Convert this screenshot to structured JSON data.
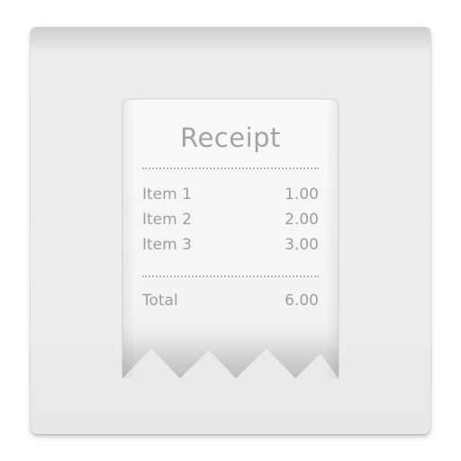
{
  "receipt": {
    "title": "Receipt",
    "items": [
      {
        "name": "Item 1",
        "amount": "1.00"
      },
      {
        "name": "Item 2",
        "amount": "2.00"
      },
      {
        "name": "Item 3",
        "amount": "3.00"
      }
    ],
    "total": {
      "label": "Total",
      "amount": "6.00"
    }
  },
  "colors": {
    "tile": "#ebebeb",
    "paper": "#f7f7f7",
    "text": "#9e9e9e"
  }
}
